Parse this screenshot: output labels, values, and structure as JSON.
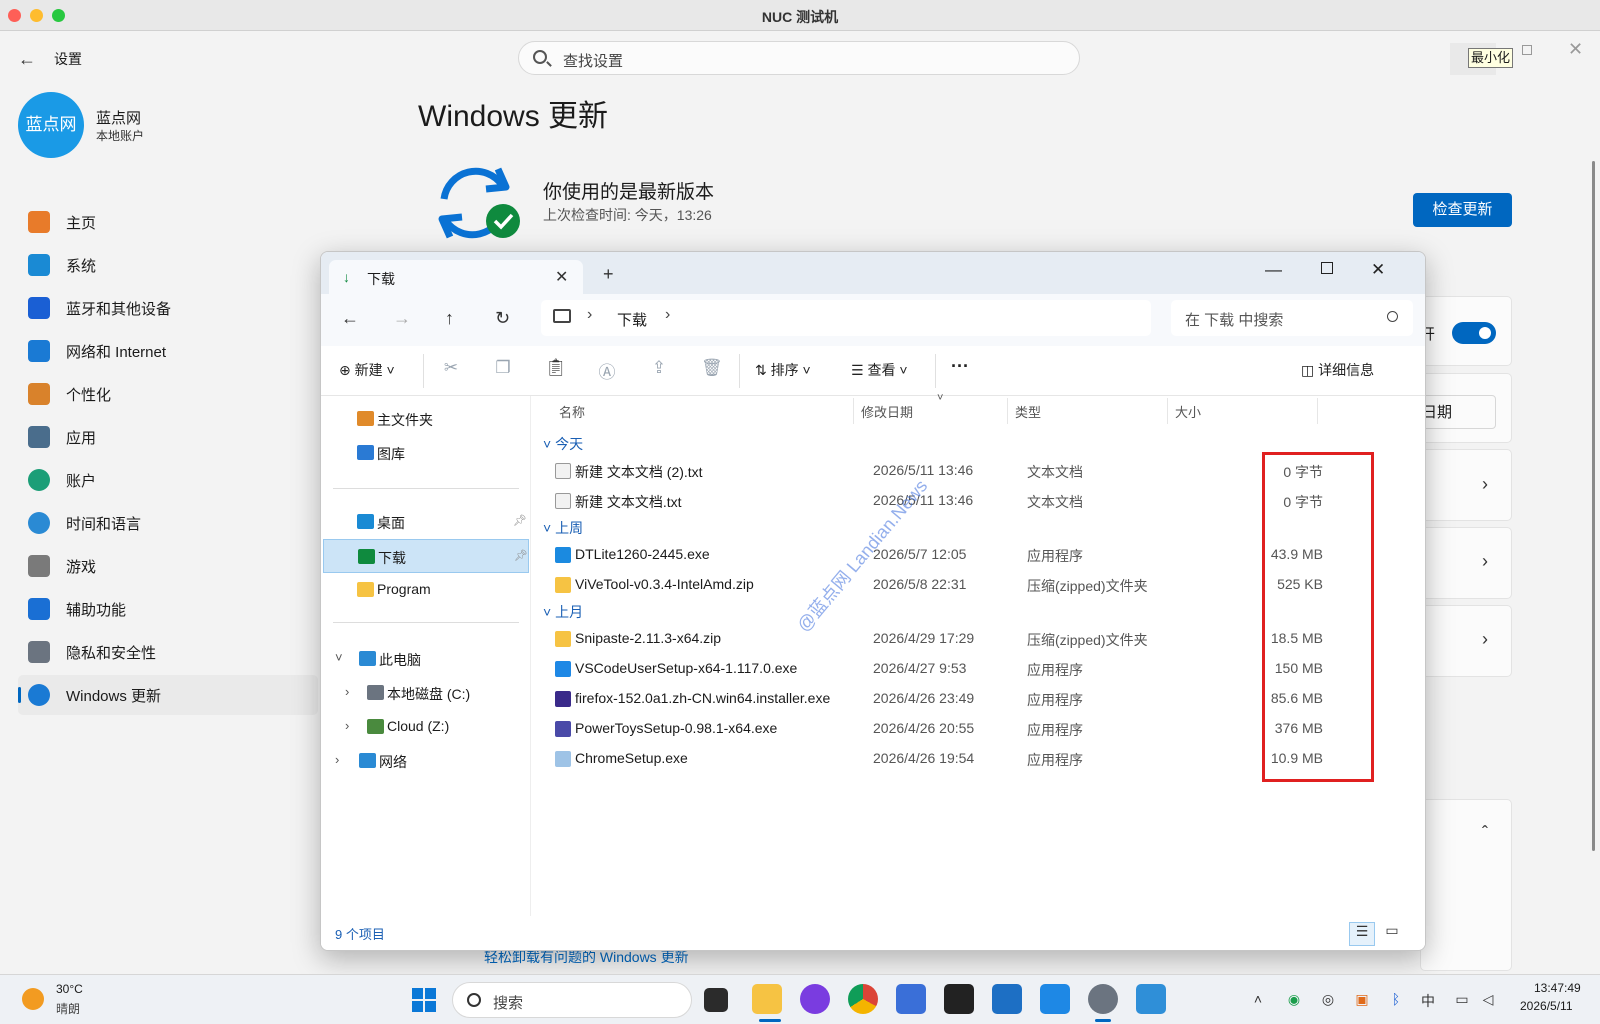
{
  "window_title": "NUC 测试机",
  "settings": {
    "back_label": "设置",
    "search_placeholder": "查找设置",
    "minimize_tooltip": "最小化",
    "profile": {
      "avatar_text": "蓝点网",
      "name": "蓝点网",
      "account": "本地账户"
    },
    "nav": [
      {
        "label": "主页",
        "icon": "home-icon"
      },
      {
        "label": "系统",
        "icon": "display-icon"
      },
      {
        "label": "蓝牙和其他设备",
        "icon": "bluetooth-icon"
      },
      {
        "label": "网络和 Internet",
        "icon": "wifi-icon"
      },
      {
        "label": "个性化",
        "icon": "brush-icon"
      },
      {
        "label": "应用",
        "icon": "apps-icon"
      },
      {
        "label": "账户",
        "icon": "person-icon"
      },
      {
        "label": "时间和语言",
        "icon": "globe-clock-icon"
      },
      {
        "label": "游戏",
        "icon": "gamepad-icon"
      },
      {
        "label": "辅助功能",
        "icon": "accessibility-icon"
      },
      {
        "label": "隐私和安全性",
        "icon": "shield-icon"
      },
      {
        "label": "Windows 更新",
        "icon": "sync-icon",
        "active": true
      }
    ],
    "page_title": "Windows 更新",
    "status_title": "你使用的是最新版本",
    "status_sub": "上次检查时间: 今天，13:26",
    "check_button": "检查更新",
    "toggle_label": "开",
    "date_label": "日期",
    "link_text": "轻松卸载有问题的 Windows 更新"
  },
  "explorer": {
    "tab_label": "下载",
    "address": "下载",
    "search_placeholder": "在 下载 中搜索",
    "toolbar": {
      "new": "新建",
      "sort": "排序",
      "view": "查看",
      "more": "···",
      "details": "详细信息"
    },
    "tree": [
      {
        "label": "主文件夹",
        "icon": "home-folder-icon"
      },
      {
        "label": "图库",
        "icon": "gallery-icon"
      },
      {
        "label": "桌面",
        "icon": "desktop-icon",
        "pinned": true
      },
      {
        "label": "下载",
        "icon": "download-icon",
        "pinned": true,
        "selected": true
      },
      {
        "label": "Program",
        "icon": "folder-icon"
      },
      {
        "label": "此电脑",
        "icon": "pc-icon",
        "expanded": true
      },
      {
        "label": "本地磁盘 (C:)",
        "icon": "drive-icon"
      },
      {
        "label": "Cloud (Z:)",
        "icon": "network-drive-icon"
      },
      {
        "label": "网络",
        "icon": "network-icon"
      }
    ],
    "columns": [
      "名称",
      "修改日期",
      "类型",
      "大小"
    ],
    "groups": [
      {
        "label": "今天",
        "files": [
          {
            "name": "新建 文本文档 (2).txt",
            "date": "2026/5/11 13:46",
            "type": "文本文档",
            "size": "0 字节",
            "icon": "txt-file-icon"
          },
          {
            "name": "新建 文本文档.txt",
            "date": "2026/5/11 13:46",
            "type": "文本文档",
            "size": "0 字节",
            "icon": "txt-file-icon"
          }
        ]
      },
      {
        "label": "上周",
        "files": [
          {
            "name": "DTLite1260-2445.exe",
            "date": "2026/5/7 12:05",
            "type": "应用程序",
            "size": "43.9 MB",
            "icon": "daemon-tools-icon"
          },
          {
            "name": "ViVeTool-v0.3.4-IntelAmd.zip",
            "date": "2026/5/8 22:31",
            "type": "压缩(zipped)文件夹",
            "size": "525 KB",
            "icon": "zip-folder-icon"
          }
        ]
      },
      {
        "label": "上月",
        "files": [
          {
            "name": "Snipaste-2.11.3-x64.zip",
            "date": "2026/4/29 17:29",
            "type": "压缩(zipped)文件夹",
            "size": "18.5 MB",
            "icon": "zip-folder-icon"
          },
          {
            "name": "VSCodeUserSetup-x64-1.117.0.exe",
            "date": "2026/4/27 9:53",
            "type": "应用程序",
            "size": "150 MB",
            "icon": "vscode-icon"
          },
          {
            "name": "firefox-152.0a1.zh-CN.win64.installer.exe",
            "date": "2026/4/26 23:49",
            "type": "应用程序",
            "size": "85.6 MB",
            "icon": "firefox-installer-icon"
          },
          {
            "name": "PowerToysSetup-0.98.1-x64.exe",
            "date": "2026/4/26 20:55",
            "type": "应用程序",
            "size": "376 MB",
            "icon": "powertoys-icon"
          },
          {
            "name": "ChromeSetup.exe",
            "date": "2026/4/26 19:54",
            "type": "应用程序",
            "size": "10.9 MB",
            "icon": "chrome-setup-icon"
          }
        ]
      }
    ],
    "item_count": "9 个项目",
    "watermark": "@蓝点网 Landian.News"
  },
  "taskbar": {
    "weather_temp": "30°C",
    "weather_desc": "晴朗",
    "search_placeholder": "搜索",
    "tray_lang": "中",
    "clock_time": "13:47:49",
    "clock_date": "2026/5/11"
  },
  "colors": {
    "accent": "#0067c0",
    "highlight_box": "#e02020",
    "avatar": "#1a9ae6"
  }
}
